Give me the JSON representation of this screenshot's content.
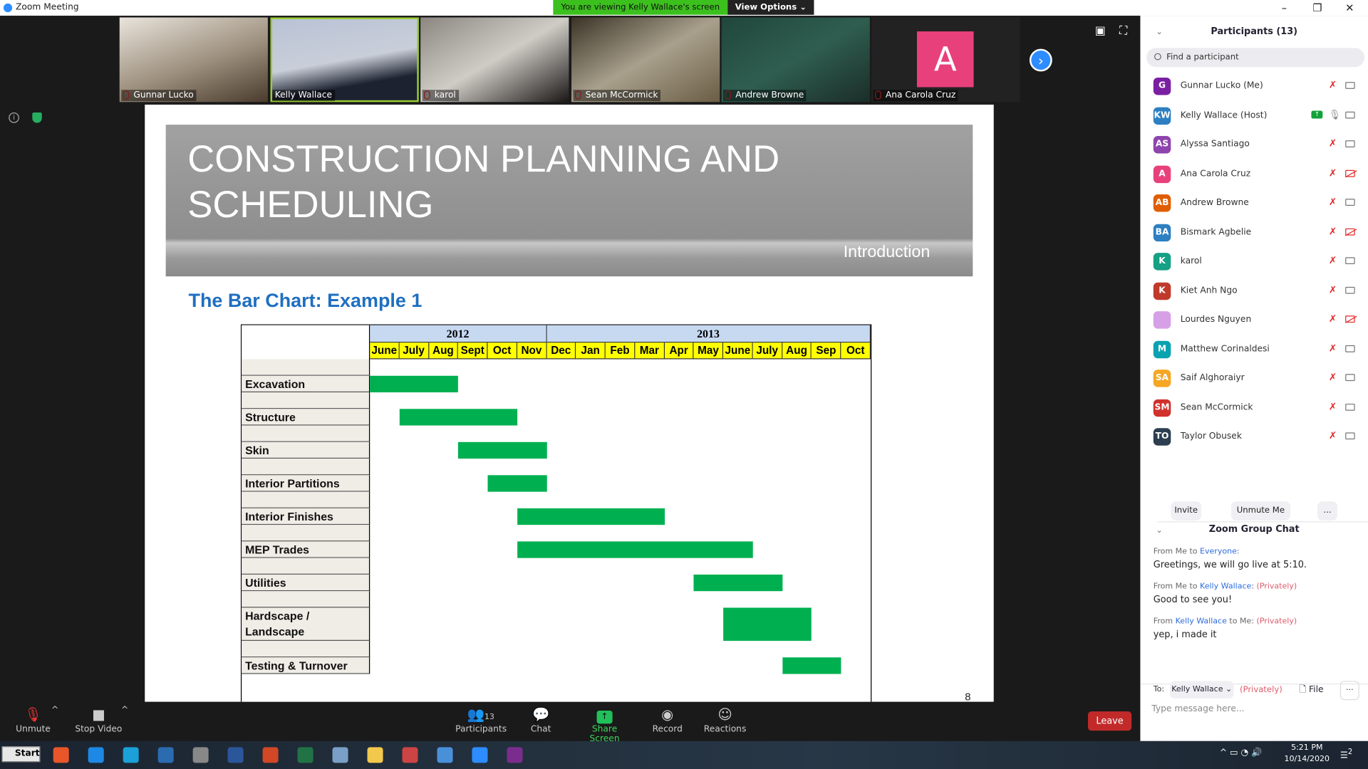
{
  "window": {
    "title": "Zoom Meeting",
    "banner": "You are viewing Kelly Wallace's screen",
    "view_options": "View Options ⌄",
    "minimize": "–",
    "restore": "❐",
    "close": "✕"
  },
  "videos": [
    {
      "name": "Gunnar Lucko",
      "muted": true
    },
    {
      "name": "Kelly Wallace",
      "muted": false,
      "active": true
    },
    {
      "name": "karol",
      "muted": true
    },
    {
      "name": "Sean McCormick",
      "muted": true
    },
    {
      "name": "Andrew Browne",
      "muted": true
    },
    {
      "name": "Ana Carola Cruz",
      "muted": true,
      "avatar_letter": "A"
    }
  ],
  "slide": {
    "title": "CONSTRUCTION PLANNING AND SCHEDULING",
    "subtitle": "Introduction",
    "chart_heading": "The Bar Chart: Example 1",
    "page_number": "8"
  },
  "chart_data": {
    "type": "bar",
    "orientation": "gantt",
    "years": [
      {
        "label": "2012",
        "months": 6
      },
      {
        "label": "2013",
        "months": 11
      }
    ],
    "months": [
      "June",
      "July",
      "Aug",
      "Sept",
      "Oct",
      "Nov",
      "Dec",
      "Jan",
      "Feb",
      "Mar",
      "Apr",
      "May",
      "June",
      "July",
      "Aug",
      "Sep",
      "Oct"
    ],
    "tasks": [
      {
        "name": "Excavation",
        "start": "2012-06",
        "end": "2012-08"
      },
      {
        "name": "Structure",
        "start": "2012-07",
        "end": "2012-10"
      },
      {
        "name": "Skin",
        "start": "2012-09",
        "end": "2012-11"
      },
      {
        "name": "Interior Partitions",
        "start": "2012-10",
        "end": "2012-11"
      },
      {
        "name": "Interior Finishes",
        "start": "2012-11",
        "end": "2013-03"
      },
      {
        "name": "MEP Trades",
        "start": "2012-11",
        "end": "2013-06"
      },
      {
        "name": "Utilities",
        "start": "2013-05",
        "end": "2013-07"
      },
      {
        "name": "Hardscape / Landscape",
        "start": "2013-06",
        "end": "2013-08"
      },
      {
        "name": "Testing & Turnover",
        "start": "2013-08",
        "end": "2013-09"
      }
    ],
    "bar_color": "#00b050",
    "year_header_color": "#c6d9f1",
    "month_header_color": "#ffff00"
  },
  "toolbar": {
    "unmute": "Unmute",
    "stop_video": "Stop Video",
    "participants": "Participants",
    "participants_count": "13",
    "chat": "Chat",
    "share_screen": "Share Screen",
    "record": "Record",
    "reactions": "Reactions",
    "leave": "Leave"
  },
  "participants": {
    "title": "Participants (13)",
    "search_placeholder": "Find a participant",
    "list": [
      {
        "initials": "G",
        "name": "Gunnar Lucko (Me)",
        "color": "#7b1fa2",
        "mic": "muted",
        "cam": "on"
      },
      {
        "initials": "KW",
        "name": "Kelly Wallace (Host)",
        "color": "#2d7fc1",
        "mic": "on",
        "cam": "on",
        "sharing": true
      },
      {
        "initials": "AS",
        "name": "Alyssa Santiago",
        "color": "#8e44ad",
        "mic": "muted",
        "cam": "on"
      },
      {
        "initials": "A",
        "name": "Ana Carola Cruz",
        "color": "#e8407a",
        "mic": "muted",
        "cam": "off"
      },
      {
        "initials": "AB",
        "name": "Andrew Browne",
        "color": "#e05d00",
        "mic": "muted",
        "cam": "on"
      },
      {
        "initials": "BA",
        "name": "Bismark Agbelie",
        "color": "#2d7fc1",
        "mic": "muted",
        "cam": "off"
      },
      {
        "initials": "K",
        "name": "karol",
        "color": "#16a085",
        "mic": "muted",
        "cam": "on"
      },
      {
        "initials": "K",
        "name": "Kiet Anh Ngo",
        "color": "#c0392b",
        "mic": "muted",
        "cam": "on"
      },
      {
        "initials": "",
        "name": "Lourdes Nguyen",
        "color": "#d7a0e6",
        "mic": "muted",
        "cam": "off"
      },
      {
        "initials": "M",
        "name": "Matthew Corinaldesi",
        "color": "#0aa2b0",
        "mic": "muted",
        "cam": "on"
      },
      {
        "initials": "SA",
        "name": "Saif Alghoraiyr",
        "color": "#f5a623",
        "mic": "muted",
        "cam": "on"
      },
      {
        "initials": "SM",
        "name": "Sean McCormick",
        "color": "#d0312d",
        "mic": "muted",
        "cam": "on"
      },
      {
        "initials": "TO",
        "name": "Taylor Obusek",
        "color": "#2c3e50",
        "mic": "muted",
        "cam": "on"
      }
    ],
    "invite": "Invite",
    "unmute_me": "Unmute Me",
    "more": "..."
  },
  "chat": {
    "title": "Zoom Group Chat",
    "messages": [
      {
        "from": "Me",
        "to": "Everyone",
        "private": "",
        "text": "Greetings, we will go live at 5:10."
      },
      {
        "from": "Me",
        "to": "Kelly Wallace",
        "private": "(Privately)",
        "text": "Good to see you!"
      },
      {
        "from": "Kelly Wallace",
        "to": "Me",
        "private": "(Privately)",
        "text": "yep, i made it"
      }
    ],
    "from_prefix": "From",
    "to_word": "to",
    "to_label": "To:",
    "recipient": "Kelly Wallace ⌄",
    "privately": "(Privately)",
    "file": "File",
    "more": "···",
    "input_placeholder": "Type message here..."
  },
  "taskbar": {
    "start": "Start",
    "time": "5:21 PM",
    "date": "10/14/2020",
    "notifications": "2"
  }
}
